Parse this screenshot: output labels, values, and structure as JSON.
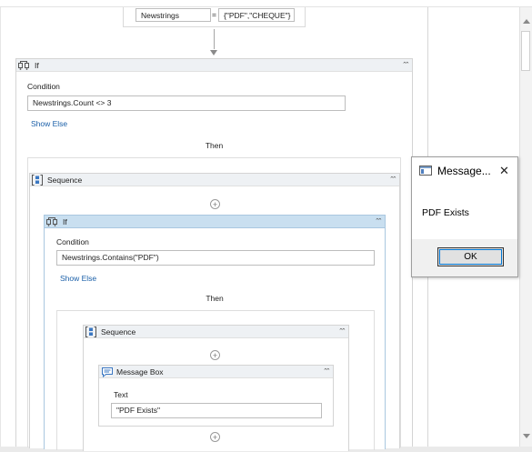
{
  "assign": {
    "target": "Newstrings",
    "operator": "=",
    "value": "{\"PDF\",\"CHEQUE\"}"
  },
  "if_outer": {
    "title": "If",
    "condition_label": "Condition",
    "condition": "Newstrings.Count <> 3",
    "show_else": "Show Else",
    "then": "Then"
  },
  "sequence_outer": {
    "title": "Sequence"
  },
  "if_inner": {
    "title": "If",
    "condition_label": "Condition",
    "condition": "Newstrings.Contains(\"PDF\")",
    "show_else": "Show Else",
    "then": "Then"
  },
  "sequence_inner": {
    "title": "Sequence"
  },
  "message_box": {
    "title": "Message Box",
    "text_label": "Text",
    "text_value": "\"PDF Exists\""
  },
  "dialog": {
    "title": "Message...",
    "close": "✕",
    "message": "PDF Exists",
    "ok_label": "OK"
  },
  "icons": {
    "collapse": "⌃⌃",
    "plus": "+"
  }
}
